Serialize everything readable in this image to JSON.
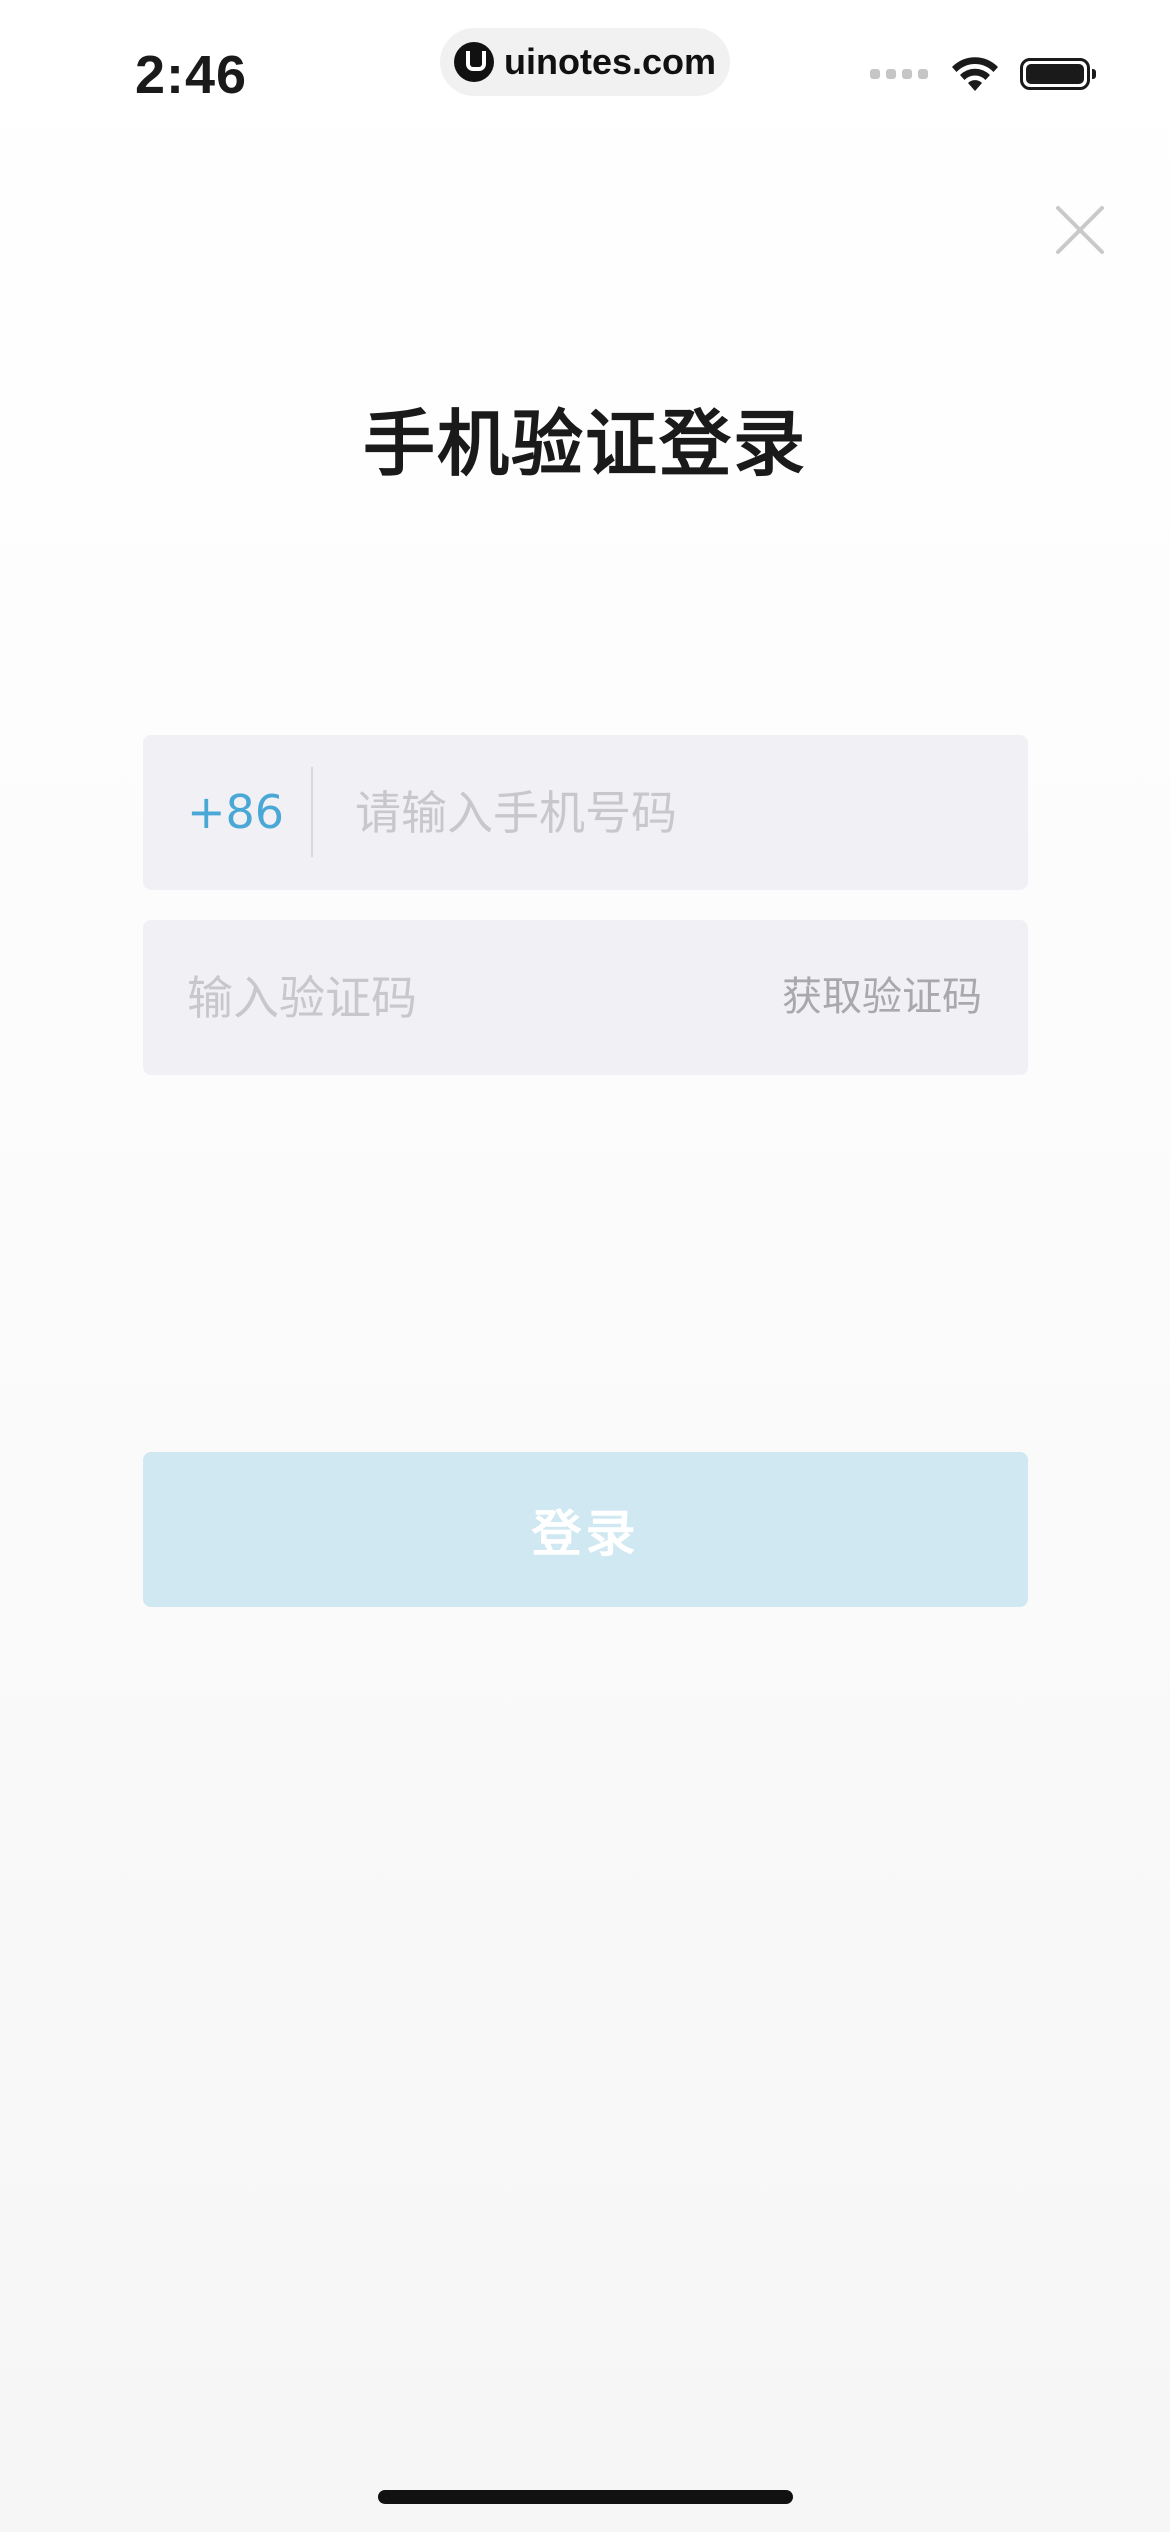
{
  "status_bar": {
    "time": "2:46",
    "watermark": "uinotes.com",
    "icons": [
      "signal-icon",
      "wifi-icon",
      "battery-icon"
    ]
  },
  "header": {
    "close_icon": "close-icon"
  },
  "title": "手机验证登录",
  "phone_field": {
    "country_code": "+86",
    "placeholder": "请输入手机号码",
    "value": ""
  },
  "code_field": {
    "placeholder": "输入验证码",
    "value": "",
    "get_code_label": "获取验证码"
  },
  "login_button": {
    "label": "登录"
  },
  "colors": {
    "accent": "#4aa8d6",
    "button_disabled": "#d0e8f2",
    "field_bg": "#f1f0f5",
    "placeholder": "#c8c8cc"
  }
}
